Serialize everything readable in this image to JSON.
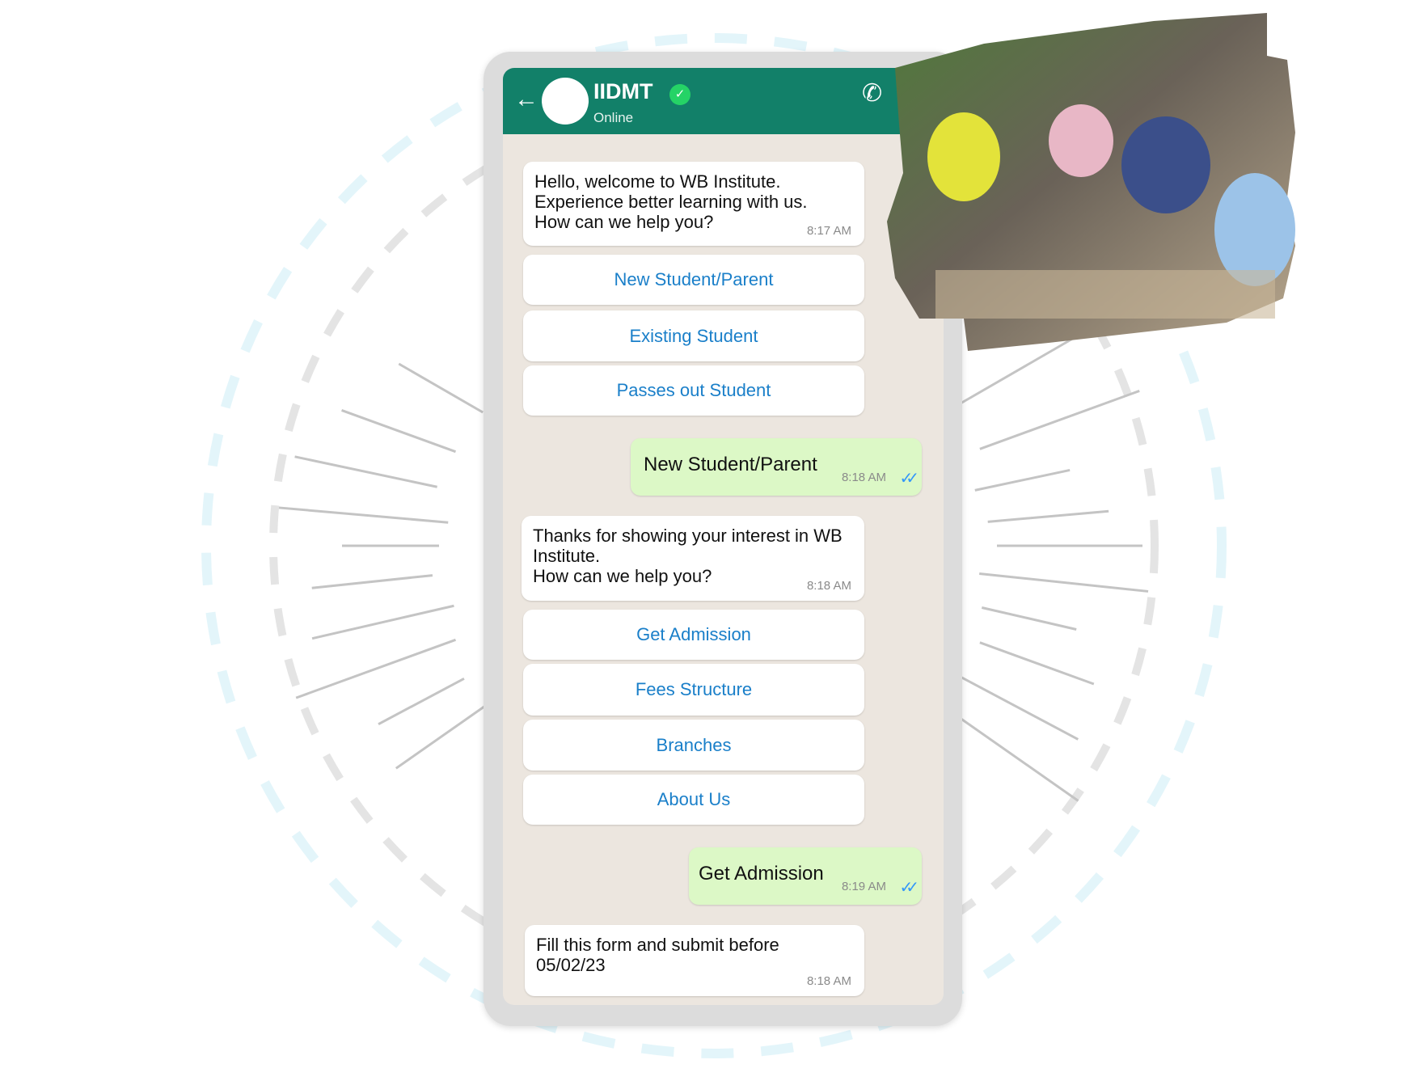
{
  "header": {
    "title": "IIDMT",
    "status": "Online",
    "back_icon": "arrow-left",
    "call_icon": "add-call",
    "verified_icon": "verified-badge"
  },
  "colors": {
    "header": "#128069",
    "sent_bubble": "#dcf8c6",
    "button_text": "#1a7fc9",
    "chat_bg": "#ece6df",
    "ticks": "#3497f9"
  },
  "messages": [
    {
      "lines": [
        "Hello, welcome to WB Institute.",
        "Experience better learning with us.",
        "How can we help you?"
      ],
      "time": "8:17 AM"
    },
    {
      "text": "New Student/Parent",
      "time": "8:18 AM"
    },
    {
      "lines": [
        "Thanks for showing your interest in WB",
        "Institute.",
        "How can we help you?"
      ],
      "time": "8:18 AM"
    },
    {
      "text": "Get Admission",
      "time": "8:19 AM"
    },
    {
      "lines": [
        "Fill this form and submit before",
        "05/02/23"
      ],
      "time": "8:18 AM"
    }
  ],
  "quick_replies_1": [
    "New Student/Parent",
    "Existing Student",
    "Passes out Student"
  ],
  "quick_replies_2": [
    "Get Admission",
    "Fees Structure",
    "Branches",
    "About Us"
  ]
}
